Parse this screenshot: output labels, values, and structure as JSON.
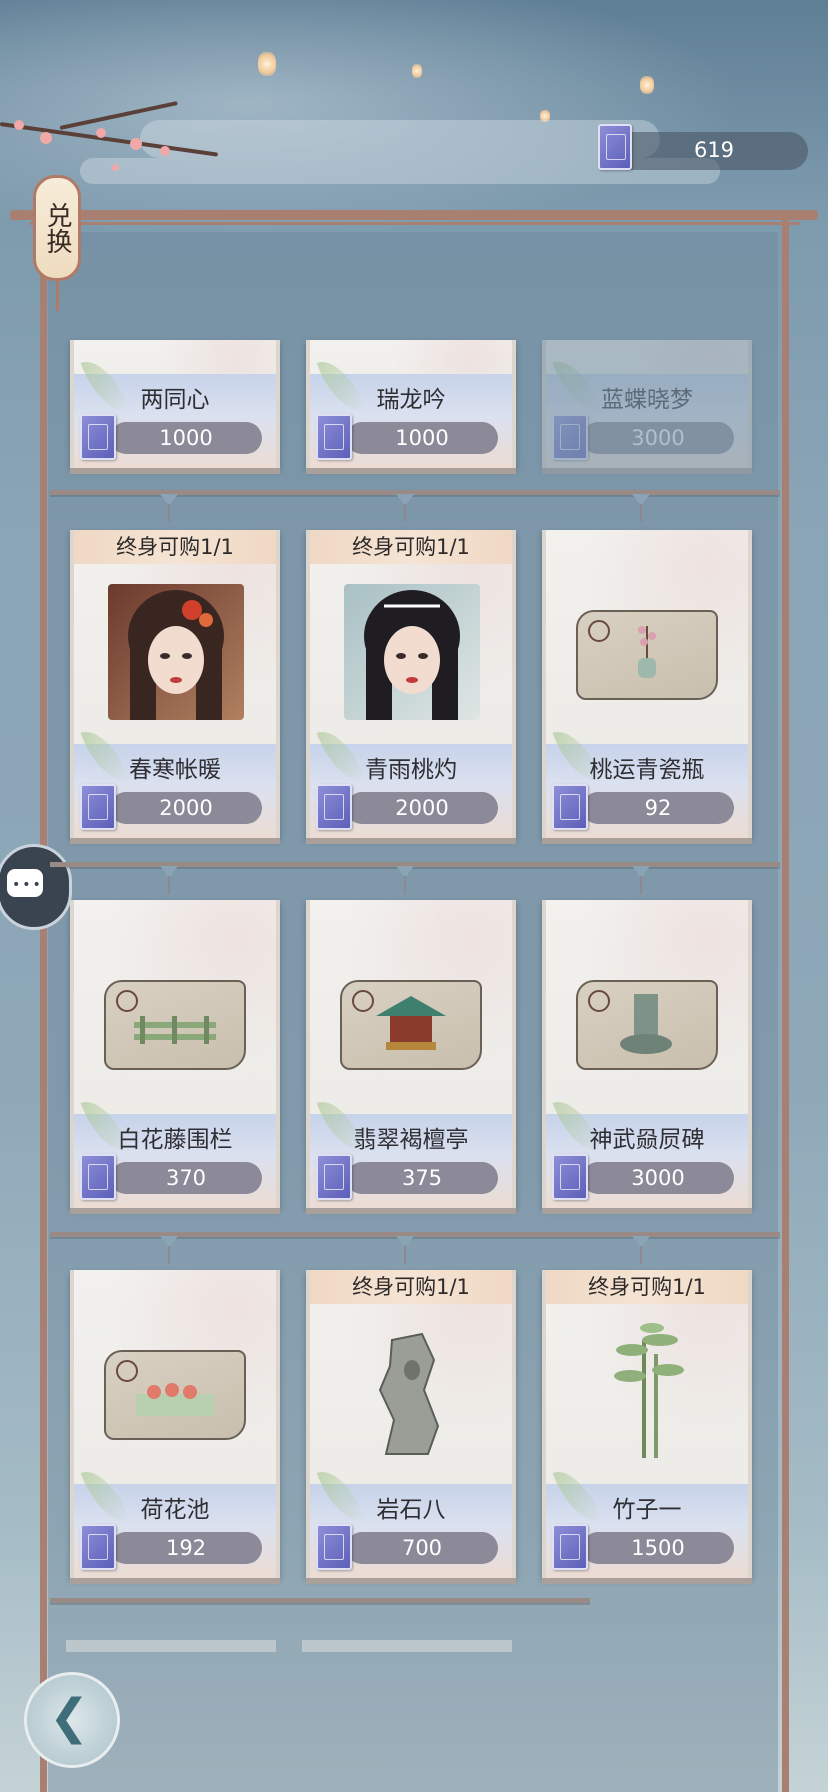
{
  "currency": {
    "value": "619",
    "icon": "book-icon"
  },
  "redeem_tag": {
    "label": "兑换"
  },
  "colors": {
    "frame": "#a97f72",
    "price_pill": "#8c8a98",
    "banner": "#f5e4d4"
  },
  "rows": [
    {
      "items": [
        {
          "name": "两同心",
          "price": "1000",
          "limit": "",
          "faded": false
        },
        {
          "name": "瑞龙吟",
          "price": "1000",
          "limit": "",
          "faded": false
        },
        {
          "name": "蓝蝶晓梦",
          "price": "3000",
          "limit": "",
          "faded": true
        }
      ]
    },
    {
      "items": [
        {
          "name": "春寒帐暖",
          "price": "2000",
          "limit": "终身可购1/1",
          "faded": false,
          "image": "portrait-red-hair"
        },
        {
          "name": "青雨桃灼",
          "price": "2000",
          "limit": "终身可购1/1",
          "faded": false,
          "image": "portrait-black-hair"
        },
        {
          "name": "桃运青瓷瓶",
          "price": "92",
          "limit": "",
          "faded": false,
          "image": "vase-pillow"
        }
      ]
    },
    {
      "items": [
        {
          "name": "白花藤围栏",
          "price": "370",
          "limit": "",
          "faded": false,
          "image": "fence-pillow"
        },
        {
          "name": "翡翠褐檀亭",
          "price": "375",
          "limit": "",
          "faded": false,
          "image": "pavilion-pillow"
        },
        {
          "name": "神武赑屃碑",
          "price": "3000",
          "limit": "",
          "faded": false,
          "image": "stele-pillow"
        }
      ]
    },
    {
      "items": [
        {
          "name": "荷花池",
          "price": "192",
          "limit": "",
          "faded": false,
          "image": "pond-pillow"
        },
        {
          "name": "岩石八",
          "price": "700",
          "limit": "终身可购1/1",
          "faded": false,
          "image": "rock"
        },
        {
          "name": "竹子一",
          "price": "1500",
          "limit": "终身可购1/1",
          "faded": false,
          "image": "bamboo"
        }
      ]
    }
  ]
}
